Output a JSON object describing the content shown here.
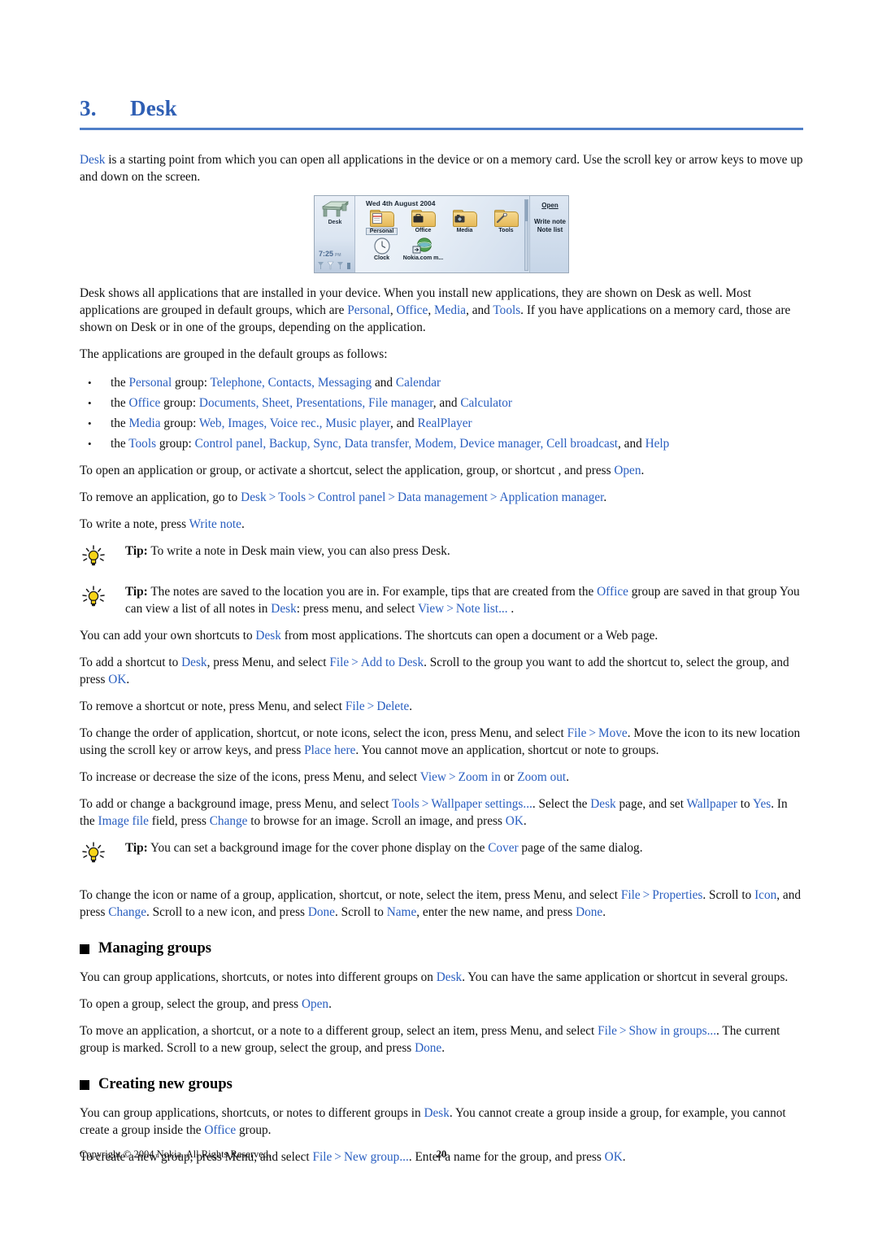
{
  "document": {
    "chapter_number": "3.",
    "chapter_title": "Desk"
  },
  "intro": {
    "p1_a": "Desk",
    "p1_b": " is a starting point from which you can open all applications in the device or on a memory card. Use the scroll key or arrow keys to move up and down on the screen."
  },
  "device_screenshot": {
    "sidebar": {
      "desk_label": "Desk",
      "time": "7:25",
      "ampm": "PM"
    },
    "date": "Wed 4th August 2004",
    "items": [
      {
        "label": "Personal",
        "selected": true
      },
      {
        "label": "Office",
        "selected": false
      },
      {
        "label": "Media",
        "selected": false
      },
      {
        "label": "Tools",
        "selected": false
      },
      {
        "label": "Clock",
        "selected": false
      },
      {
        "label": "Nokia.com m...",
        "selected": false
      }
    ],
    "commands": [
      "Open",
      "Write note",
      "Note list"
    ]
  },
  "para_shows": {
    "a": "Desk shows all applications that are installed in your device. When you install new applications, they are shown on Desk as well. Most applications are grouped in default groups, which are ",
    "l1": "Personal",
    "b": ", ",
    "l2": "Office",
    "c": ", ",
    "l3": "Media",
    "d": ", and ",
    "l4": "Tools",
    "e": ". If you have applications on a memory card, those are shown on Desk or in one of the groups, depending on the application."
  },
  "para_grouped": "The applications are grouped in the default groups as follows:",
  "app_groups": [
    {
      "prefix": "the ",
      "group": "Personal",
      "mid": " group: ",
      "apps": "Telephone, Contacts, Messaging",
      "tail_plain": " and ",
      "tail_link": "Calendar"
    },
    {
      "prefix": "the ",
      "group": "Office",
      "mid": " group: ",
      "apps": "Documents, Sheet, Presentations, File manager",
      "tail_plain": ", and ",
      "tail_link": "Calculator"
    },
    {
      "prefix": "the ",
      "group": "Media",
      "mid": " group: ",
      "apps": "Web, Images, Voice rec., Music player",
      "tail_plain": ", and ",
      "tail_link": "RealPlayer"
    },
    {
      "prefix": "the ",
      "group": "Tools",
      "mid": " group: ",
      "apps": "Control panel, Backup, Sync, Data transfer, Modem, Device manager, Cell broadcast",
      "tail_plain": ", and ",
      "tail_link": "Help"
    }
  ],
  "instructions": {
    "open_app_a": "To open an application or group, or activate a shortcut, select the application, group, or shortcut , and press ",
    "open_app_link": "Open",
    "open_app_b": ".",
    "remove_app_a": "To remove an application, go to ",
    "remove_app_l1": "Desk",
    "remove_app_l2": "Tools",
    "remove_app_l3": "Control panel",
    "remove_app_l4": "Data management",
    "remove_app_l5": "Application manager",
    "remove_app_b": ".",
    "write_note_a": "To write a note, press ",
    "write_note_link": "Write note",
    "write_note_b": "."
  },
  "tips": {
    "tip1_label": "Tip:",
    "tip1_text": " To write a note in Desk main view, you can also press Desk.",
    "tip2_label": "Tip:",
    "tip2_a": " The notes are saved to the location you are in. For example, tips that are created from the ",
    "tip2_l1": "Office",
    "tip2_b": " group are saved in that group You can view a list of all notes in ",
    "tip2_l2": "Desk",
    "tip2_c": ": press menu, and select ",
    "tip2_l3": "View",
    "tip2_l4": "Note list...",
    "tip2_d": " .",
    "tip3_label": "Tip:",
    "tip3_a": " You can set a background image for the cover phone display on the ",
    "tip3_l1": "Cover",
    "tip3_b": " page of the same dialog."
  },
  "shortcuts": {
    "own_a": "You can add your own shortcuts to ",
    "own_l1": "Desk",
    "own_b": " from most applications. The shortcuts can open a document or a Web page.",
    "add_a": "To add a shortcut to ",
    "add_l1": "Desk",
    "add_b": ", press Menu, and select ",
    "add_l2": "File",
    "add_l3": "Add to Desk",
    "add_c": ". Scroll to the group you want to add the shortcut to, select the group, and press ",
    "add_l4": "OK",
    "add_d": ".",
    "remove_a": "To remove a shortcut or note, press Menu, and select ",
    "remove_l1": "File",
    "remove_l2": "Delete",
    "remove_b": ".",
    "order_a": "To change the order of application, shortcut, or note icons, select the icon, press Menu, and select ",
    "order_l1": "File",
    "order_l2": "Move",
    "order_b": ". Move the icon to its new location using the scroll key or arrow keys, and press ",
    "order_l3": "Place here",
    "order_c": ". You cannot move an application, shortcut or note to groups.",
    "zoom_a": "To increase or decrease the size of the icons, press Menu, and select ",
    "zoom_l1": "View",
    "zoom_l2": "Zoom in",
    "zoom_b": " or ",
    "zoom_l3": "Zoom out",
    "zoom_c": ".",
    "bg_a": "To add or change a background image, press Menu, and select ",
    "bg_l1": "Tools",
    "bg_l2": "Wallpaper settings...",
    "bg_b": ". Select the ",
    "bg_l3": "Desk",
    "bg_c": " page, and set ",
    "bg_l4": "Wallpaper",
    "bg_d": " to ",
    "bg_l5": "Yes",
    "bg_e": ". In the ",
    "bg_l6": "Image file",
    "bg_f": " field, press ",
    "bg_l7": "Change",
    "bg_g": " to browse for an image. Scroll an image, and press ",
    "bg_l8": "OK",
    "bg_h": ".",
    "icon_a": "To change the icon or name of a group, application, shortcut, or note, select the item, press Menu, and select ",
    "icon_l1": "File",
    "icon_l2": "Properties",
    "icon_b": ". Scroll to ",
    "icon_l3": "Icon",
    "icon_c": ", and press ",
    "icon_l4": "Change",
    "icon_d": ". Scroll to a new icon, and press ",
    "icon_l5": "Done",
    "icon_e": ". Scroll to ",
    "icon_l6": "Name",
    "icon_f": ", enter the new name, and press ",
    "icon_l7": "Done",
    "icon_g": "."
  },
  "managing_groups": {
    "heading": "Managing groups",
    "p1_a": "You can group applications, shortcuts, or notes into different groups on ",
    "p1_l1": "Desk",
    "p1_b": ". You can have the same application or shortcut in several groups.",
    "p2_a": "To open a group, select the group, and press ",
    "p2_l1": "Open",
    "p2_b": ".",
    "p3_a": "To move an application, a shortcut, or a note to a different group, select an item, press Menu, and select ",
    "p3_l1": "File",
    "p3_l2": "Show in groups...",
    "p3_b": ". The current group is marked. Scroll to a new group, select the group, and press ",
    "p3_l3": "Done",
    "p3_c": "."
  },
  "creating_new_groups": {
    "heading": "Creating new groups",
    "p1_a": "You can group applications, shortcuts, or notes to different groups in ",
    "p1_l1": "Desk",
    "p1_b": ". You cannot create a group inside a group, for example, you cannot create a group inside the ",
    "p1_l2": "Office",
    "p1_c": " group.",
    "p2_a": "To create a new group, press Menu, and select ",
    "p2_l1": "File",
    "p2_l2": "New group...",
    "p2_b": ". Enter a name for the group, and press ",
    "p2_l3": "OK",
    "p2_c": "."
  },
  "footer": {
    "copyright": "Copyright © 2004 Nokia. All Rights Reserved.",
    "page_number": "20"
  },
  "colors": {
    "heading_blue": "#2f5fb4",
    "link_blue": "#2a5fc0",
    "rule_blue": "#4f7fc8"
  }
}
